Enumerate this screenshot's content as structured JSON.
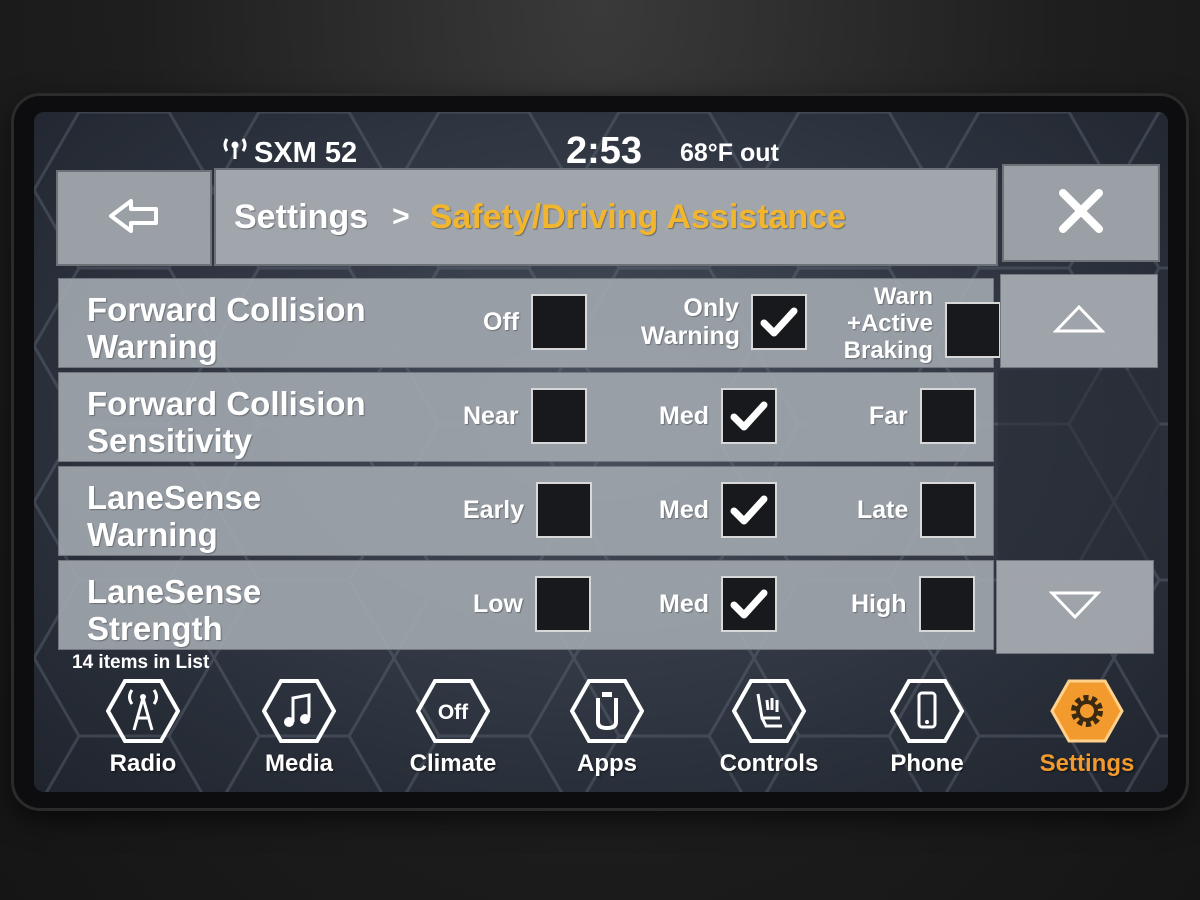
{
  "status": {
    "radio": "SXM 52",
    "time": "2:53",
    "temperature": "68°F out"
  },
  "header": {
    "breadcrumb_root": "Settings",
    "breadcrumb_separator": ">",
    "breadcrumb_current": "Safety/Driving Assistance",
    "accent_color": "#f2b62e"
  },
  "settings": [
    {
      "label_line1": "Forward Collision",
      "label_line2": "Warning",
      "options": [
        {
          "label": "Off",
          "checked": false
        },
        {
          "label": "Only Warning",
          "checked": true
        },
        {
          "label": "Warn +Active Braking",
          "checked": false
        }
      ]
    },
    {
      "label_line1": "Forward Collision",
      "label_line2": "Sensitivity",
      "options": [
        {
          "label": "Near",
          "checked": false
        },
        {
          "label": "Med",
          "checked": true
        },
        {
          "label": "Far",
          "checked": false
        }
      ]
    },
    {
      "label_line1": "LaneSense",
      "label_line2": "Warning",
      "options": [
        {
          "label": "Early",
          "checked": false
        },
        {
          "label": "Med",
          "checked": true
        },
        {
          "label": "Late",
          "checked": false
        }
      ]
    },
    {
      "label_line1": "LaneSense",
      "label_line2": "Strength",
      "options": [
        {
          "label": "Low",
          "checked": false
        },
        {
          "label": "Med",
          "checked": true
        },
        {
          "label": "High",
          "checked": false
        }
      ]
    }
  ],
  "list_count": "14 items in List",
  "nav": [
    {
      "label": "Radio",
      "icon": "radio-tower-icon"
    },
    {
      "label": "Media",
      "icon": "music-note-icon"
    },
    {
      "label": "Climate",
      "icon": "climate-off-icon",
      "icon_text": "Off"
    },
    {
      "label": "Apps",
      "icon": "apps-icon"
    },
    {
      "label": "Controls",
      "icon": "seat-controls-icon"
    },
    {
      "label": "Phone",
      "icon": "phone-icon"
    },
    {
      "label": "Settings",
      "icon": "gear-icon",
      "active": true
    }
  ],
  "nav_active_color": "#f29a2e"
}
